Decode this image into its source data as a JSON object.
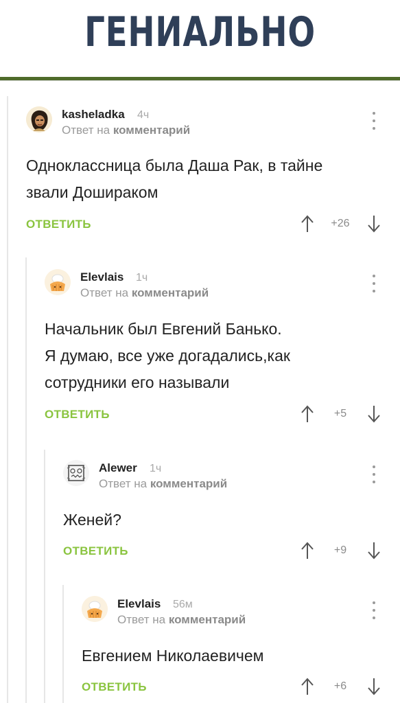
{
  "header": {
    "title": "ГЕНИАЛЬНО"
  },
  "colors": {
    "reply_button": "#8ac43f",
    "header_title": "#2f3f58",
    "header_rule": "#4f6b2a"
  },
  "comments": [
    {
      "author": "kasheladka",
      "time": "4ч",
      "reply_prefix": "Ответ на",
      "reply_target": "комментарий",
      "lines": [
        "Одноклассница была Даша Рак, в тайне",
        "звали Дошираком"
      ],
      "reply_label": "ОТВЕТИТЬ",
      "score": "+26",
      "avatar_icon": "woman-avatar-icon"
    },
    {
      "author": "Elevlais",
      "time": "1ч",
      "reply_prefix": "Ответ на",
      "reply_target": "комментарий",
      "lines": [
        "Начальник был Евгений Банько.",
        "Я думаю, все уже догадались,как",
        "сотрудники его называли"
      ],
      "reply_label": "ОТВЕТИТЬ",
      "score": "+5",
      "avatar_icon": "cupcake-avatar-icon"
    },
    {
      "author": "Alewer",
      "time": "1ч",
      "reply_prefix": "Ответ на",
      "reply_target": "комментарий",
      "lines": [
        "Женей?"
      ],
      "reply_label": "ОТВЕТИТЬ",
      "score": "+9",
      "avatar_icon": "sketch-avatar-icon"
    },
    {
      "author": "Elevlais",
      "time": "56м",
      "reply_prefix": "Ответ на",
      "reply_target": "комментарий",
      "lines": [
        "Евгением Николаевичем"
      ],
      "reply_label": "ОТВЕТИТЬ",
      "score": "+6",
      "avatar_icon": "cupcake-avatar-icon"
    }
  ]
}
